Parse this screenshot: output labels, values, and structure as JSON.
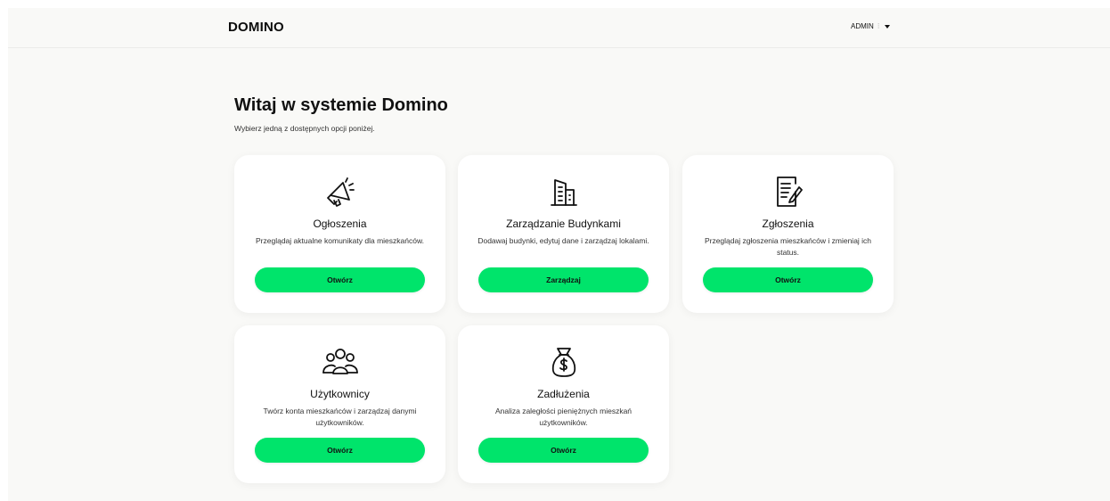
{
  "navbar": {
    "brand": "DOMINO",
    "user_label": "ADMIN",
    "separator": "⁝"
  },
  "header": {
    "title": "Witaj w systemie Domino",
    "subtitle": "Wybierz jedną z dostępnych opcji poniżej."
  },
  "colors": {
    "accent": "#00e46b",
    "background": "#f9f9f7",
    "card": "#ffffff"
  },
  "cards": [
    {
      "icon": "megaphone-icon",
      "title": "Ogłoszenia",
      "description": "Przeglądaj aktualne komunikaty dla mieszkańców.",
      "button": "Otwórz"
    },
    {
      "icon": "building-icon",
      "title": "Zarządzanie Budynkami",
      "description": "Dodawaj budynki, edytuj dane i zarządzaj lokalami.",
      "button": "Zarządzaj"
    },
    {
      "icon": "document-edit-icon",
      "title": "Zgłoszenia",
      "description": "Przeglądaj zgłoszenia mieszkańców i zmieniaj ich status.",
      "button": "Otwórz"
    },
    {
      "icon": "users-icon",
      "title": "Użytkownicy",
      "description": "Twórz konta mieszkańców i zarządzaj danymi użytkowników.",
      "button": "Otwórz"
    },
    {
      "icon": "money-bag-icon",
      "title": "Zadłużenia",
      "description": "Analiza zaległości pieniężnych mieszkań użytkowników.",
      "button": "Otwórz"
    }
  ]
}
